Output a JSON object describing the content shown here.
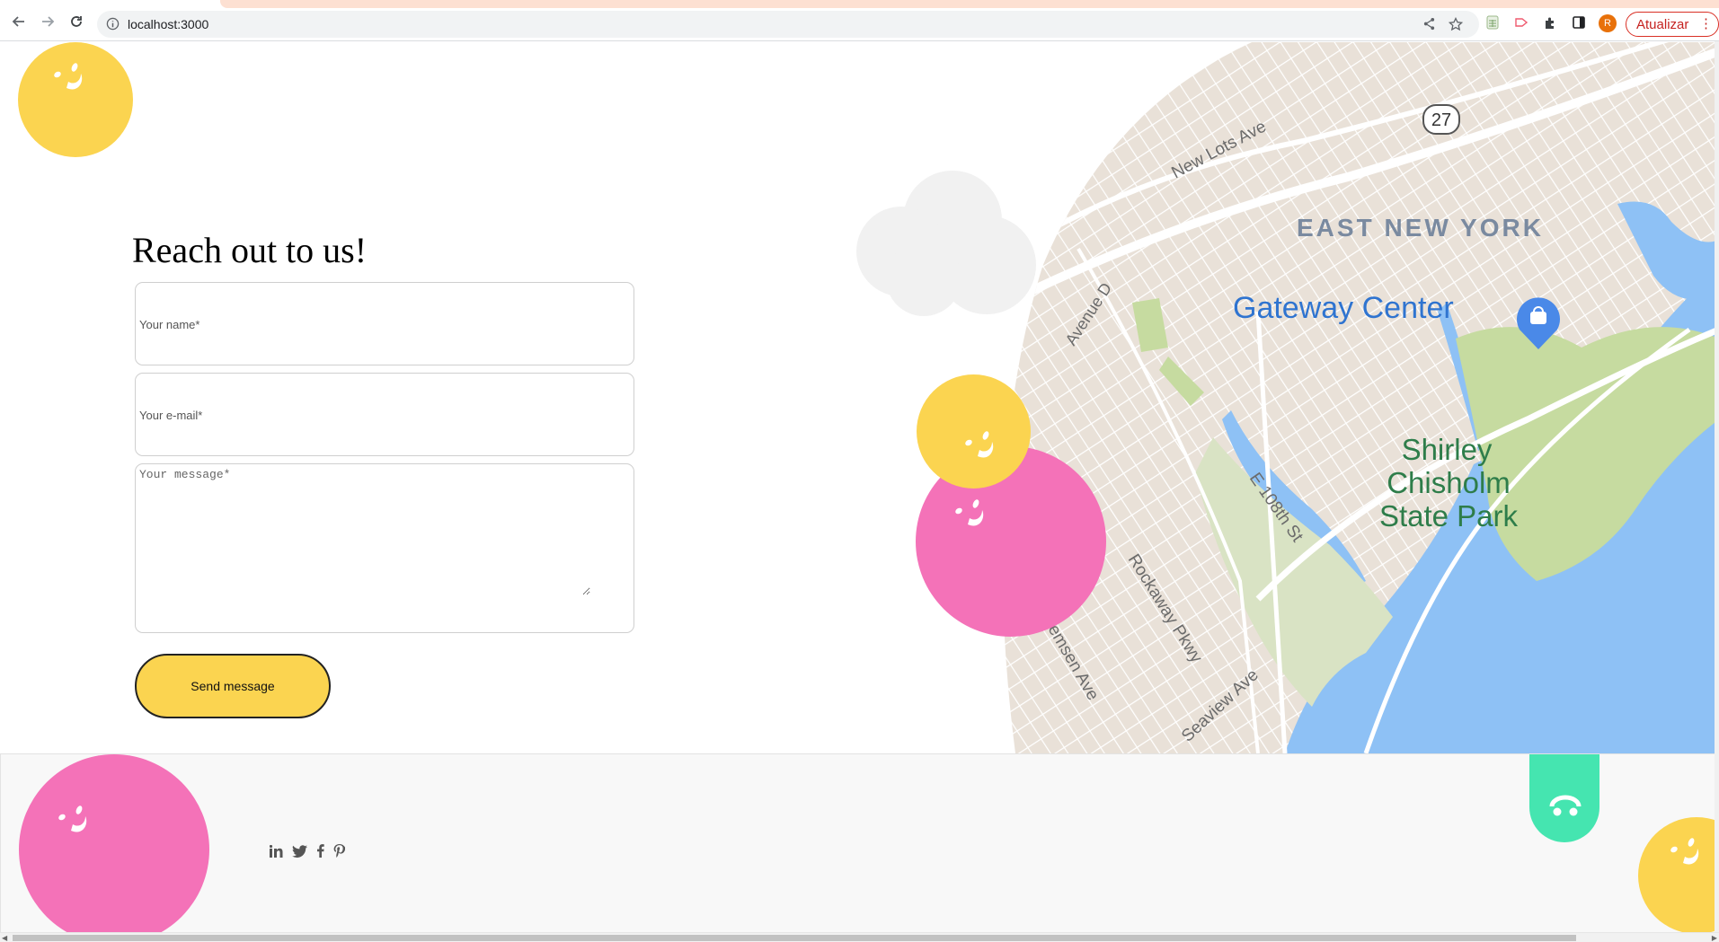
{
  "browser": {
    "url": "localhost:3000",
    "update_button": "Atualizar",
    "avatar_initial": "R",
    "menu_glyph": "⋮"
  },
  "page": {
    "heading": "Reach out to us!",
    "form": {
      "name_placeholder": "Your name*",
      "email_placeholder": "Your e-mail*",
      "message_placeholder": "Your message*",
      "submit_label": "Send message"
    }
  },
  "map": {
    "labels": {
      "highway": "27",
      "new_lots": "New Lots Ave",
      "east_new_york": "EAST NEW YORK",
      "gateway": "Gateway Center",
      "avenue_d": "Avenue D",
      "e108": "E 108th St",
      "shirley1": "Shirley",
      "shirley2": "Chisholm",
      "shirley3": "State Park",
      "rockaway": "Rockaway Pkwy",
      "remsen": "emsen Ave",
      "seaview": "Seaview Ave"
    }
  },
  "footer": {
    "social": [
      "linkedin-icon",
      "twitter-icon",
      "facebook-icon",
      "pinterest-icon"
    ]
  },
  "colors": {
    "yellow": "#fbd450",
    "pink": "#f472b8",
    "green": "#45e5b0",
    "cloud": "#f1f1f1",
    "map_land": "#eae2da",
    "map_water": "#8ec1f5",
    "map_park": "#c6dba0",
    "map_label_blue": "#2f74d0",
    "map_label_green": "#2e7d4a"
  }
}
